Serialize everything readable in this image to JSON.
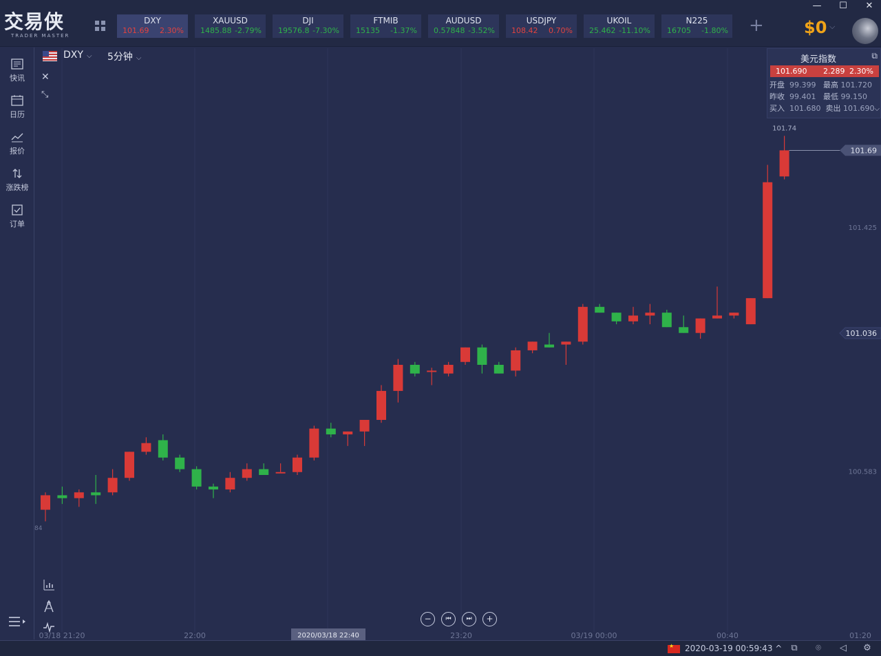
{
  "window": {
    "minimize": "—",
    "maximize": "☐",
    "close": "✕"
  },
  "logo": {
    "cn": "交易侠",
    "en": "TRADER MASTER"
  },
  "tickers": [
    {
      "symbol": "DXY",
      "price": "101.69",
      "change": "2.30%",
      "dir": "up",
      "active": true
    },
    {
      "symbol": "XAUUSD",
      "price": "1485.88",
      "change": "-2.79%",
      "dir": "dn"
    },
    {
      "symbol": "DJI",
      "price": "19576.8",
      "change": "-7.30%",
      "dir": "dn"
    },
    {
      "symbol": "FTMIB",
      "price": "15135",
      "change": "-1.37%",
      "dir": "dn"
    },
    {
      "symbol": "AUDUSD",
      "price": "0.57848",
      "change": "-3.52%",
      "dir": "dn"
    },
    {
      "symbol": "USDJPY",
      "price": "108.42",
      "change": "0.70%",
      "dir": "up"
    },
    {
      "symbol": "UKOIL",
      "price": "25.462",
      "change": "-11.10%",
      "dir": "dn"
    },
    {
      "symbol": "N225",
      "price": "16705",
      "change": "-1.80%",
      "dir": "dn"
    }
  ],
  "add_ticker": "+",
  "balance": "$0",
  "sidebar": [
    {
      "id": "news",
      "label": "快讯",
      "icon": "news-icon"
    },
    {
      "id": "calendar",
      "label": "日历",
      "icon": "calendar-icon"
    },
    {
      "id": "quotes",
      "label": "报价",
      "icon": "quotes-chart-icon"
    },
    {
      "id": "movers",
      "label": "涨跌榜",
      "icon": "up-down-arrows-icon"
    },
    {
      "id": "orders",
      "label": "订单",
      "icon": "order-icon"
    }
  ],
  "chart_head": {
    "symbol": "DXY",
    "interval": "5分钟"
  },
  "quote": {
    "title": "美元指数",
    "last": "101.690",
    "change": "2.289",
    "change_pct": "2.30%",
    "open_label": "开盘",
    "open": "99.399",
    "high_label": "最高",
    "high": "101.720",
    "prev_label": "昨收",
    "prev": "99.401",
    "low_label": "最低",
    "low": "99.150",
    "bid_label": "买入",
    "bid": "101.680",
    "ask_label": "卖出",
    "ask": "101.690"
  },
  "chart_data": {
    "type": "candlestick",
    "y_ticks": [
      "101.425",
      "100.583"
    ],
    "last_price_tag": "101.69",
    "crosshair_tag": "101.036",
    "high_label": "101.74",
    "left_axis_fragment": "84",
    "x_ticks": [
      "03/18 21:20",
      "22:00",
      "23:20",
      "03/19 00:00",
      "00:40",
      "01:20"
    ],
    "x_cursor_label": "2020/03/18 22:40",
    "candles": [
      {
        "o": 100.45,
        "h": 100.51,
        "l": 100.41,
        "c": 100.5
      },
      {
        "o": 100.5,
        "h": 100.53,
        "l": 100.47,
        "c": 100.49
      },
      {
        "o": 100.49,
        "h": 100.52,
        "l": 100.46,
        "c": 100.51
      },
      {
        "o": 100.51,
        "h": 100.57,
        "l": 100.47,
        "c": 100.5
      },
      {
        "o": 100.51,
        "h": 100.59,
        "l": 100.5,
        "c": 100.56
      },
      {
        "o": 100.56,
        "h": 100.65,
        "l": 100.55,
        "c": 100.65
      },
      {
        "o": 100.65,
        "h": 100.7,
        "l": 100.64,
        "c": 100.68
      },
      {
        "o": 100.69,
        "h": 100.71,
        "l": 100.62,
        "c": 100.63
      },
      {
        "o": 100.63,
        "h": 100.64,
        "l": 100.58,
        "c": 100.59
      },
      {
        "o": 100.59,
        "h": 100.6,
        "l": 100.52,
        "c": 100.53
      },
      {
        "o": 100.53,
        "h": 100.54,
        "l": 100.49,
        "c": 100.52
      },
      {
        "o": 100.52,
        "h": 100.58,
        "l": 100.51,
        "c": 100.56
      },
      {
        "o": 100.56,
        "h": 100.61,
        "l": 100.55,
        "c": 100.59
      },
      {
        "o": 100.59,
        "h": 100.61,
        "l": 100.57,
        "c": 100.57
      },
      {
        "o": 100.58,
        "h": 100.61,
        "l": 100.58,
        "c": 100.58
      },
      {
        "o": 100.58,
        "h": 100.64,
        "l": 100.57,
        "c": 100.63
      },
      {
        "o": 100.63,
        "h": 100.74,
        "l": 100.62,
        "c": 100.73
      },
      {
        "o": 100.73,
        "h": 100.75,
        "l": 100.7,
        "c": 100.71
      },
      {
        "o": 100.71,
        "h": 100.72,
        "l": 100.67,
        "c": 100.72
      },
      {
        "o": 100.72,
        "h": 100.76,
        "l": 100.67,
        "c": 100.76
      },
      {
        "o": 100.76,
        "h": 100.88,
        "l": 100.75,
        "c": 100.86
      },
      {
        "o": 100.86,
        "h": 100.97,
        "l": 100.82,
        "c": 100.95
      },
      {
        "o": 100.95,
        "h": 100.96,
        "l": 100.91,
        "c": 100.92
      },
      {
        "o": 100.93,
        "h": 100.94,
        "l": 100.88,
        "c": 100.93
      },
      {
        "o": 100.92,
        "h": 100.96,
        "l": 100.91,
        "c": 100.95
      },
      {
        "o": 100.96,
        "h": 101.01,
        "l": 100.95,
        "c": 101.01
      },
      {
        "o": 101.01,
        "h": 101.02,
        "l": 100.92,
        "c": 100.95
      },
      {
        "o": 100.95,
        "h": 100.96,
        "l": 100.92,
        "c": 100.92
      },
      {
        "o": 100.93,
        "h": 101.01,
        "l": 100.91,
        "c": 101.0
      },
      {
        "o": 101.0,
        "h": 101.03,
        "l": 100.99,
        "c": 101.03
      },
      {
        "o": 101.02,
        "h": 101.06,
        "l": 101.01,
        "c": 101.01
      },
      {
        "o": 101.02,
        "h": 101.03,
        "l": 100.95,
        "c": 101.03
      },
      {
        "o": 101.03,
        "h": 101.16,
        "l": 101.02,
        "c": 101.15
      },
      {
        "o": 101.15,
        "h": 101.16,
        "l": 101.13,
        "c": 101.13
      },
      {
        "o": 101.13,
        "h": 101.13,
        "l": 101.09,
        "c": 101.1
      },
      {
        "o": 101.1,
        "h": 101.15,
        "l": 101.09,
        "c": 101.12
      },
      {
        "o": 101.12,
        "h": 101.16,
        "l": 101.09,
        "c": 101.13
      },
      {
        "o": 101.13,
        "h": 101.14,
        "l": 101.08,
        "c": 101.08
      },
      {
        "o": 101.08,
        "h": 101.12,
        "l": 101.06,
        "c": 101.06
      },
      {
        "o": 101.06,
        "h": 101.11,
        "l": 101.04,
        "c": 101.11
      },
      {
        "o": 101.11,
        "h": 101.22,
        "l": 101.11,
        "c": 101.12
      },
      {
        "o": 101.12,
        "h": 101.13,
        "l": 101.11,
        "c": 101.13
      },
      {
        "o": 101.09,
        "h": 101.18,
        "l": 101.09,
        "c": 101.18
      },
      {
        "o": 101.18,
        "h": 101.64,
        "l": 101.18,
        "c": 101.58
      },
      {
        "o": 101.6,
        "h": 101.74,
        "l": 101.59,
        "c": 101.69
      }
    ]
  },
  "nav_ctrls": {
    "zoom_out": "−",
    "prev": "⏮",
    "next": "⏭",
    "zoom_in": "+"
  },
  "status": {
    "datetime": "2020-03-19 00:59:43",
    "caret": "^"
  }
}
